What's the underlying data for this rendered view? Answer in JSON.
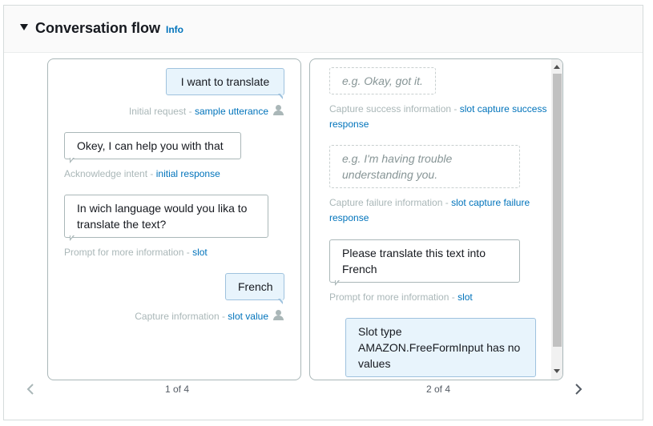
{
  "section": {
    "title": "Conversation flow",
    "info_label": "Info"
  },
  "card1": {
    "page_label": "1 of 4",
    "user_utterance": "I want to translate",
    "initial_request_caption": "Initial request - ",
    "initial_request_link": "sample utterance",
    "ack_text": "Okey, I can help you with that",
    "ack_caption": "Acknowledge intent - ",
    "ack_link": "initial response",
    "prompt_text": "In wich language would you lika to translate the text?",
    "prompt_caption": "Prompt for more information - ",
    "prompt_link": "slot",
    "answer_text": "French",
    "answer_caption": "Capture information - ",
    "answer_link": "slot value"
  },
  "card2": {
    "page_label": "2 of 4",
    "success_placeholder": "e.g. Okay, got it.",
    "success_caption": "Capture success information - ",
    "success_link": "slot capture success response",
    "failure_placeholder": "e.g. I'm having trouble understanding you.",
    "failure_caption": "Capture failure information - ",
    "failure_link": "slot capture failure response",
    "prompt_text": "Please translate this text into French",
    "prompt_caption": "Prompt for more information - ",
    "prompt_link": "slot",
    "slot_type_text": "Slot type AMAZON.FreeFormInput has no values"
  },
  "colors": {
    "link": "#0073bb",
    "user_bubble": "#e8f4fc",
    "caption": "#aab7b8"
  }
}
